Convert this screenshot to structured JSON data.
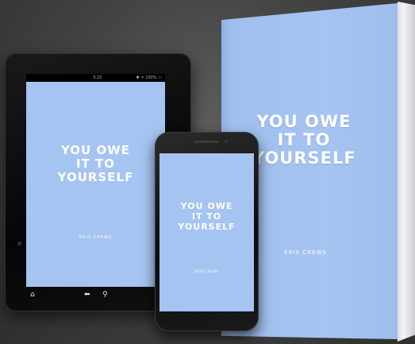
{
  "book": {
    "title": "YOU OWE\nIT TO\nYOURSELF",
    "author": "KRIS CREWS",
    "cover_color": "#a6c4f1"
  },
  "tablet": {
    "status_time": "3:23",
    "status_icons": "✱ ᯤ 100% ▭",
    "title": "YOU OWE\nIT TO\nYOURSELF",
    "author": "KRIS CREWS",
    "nav": {
      "home_icon": "home-icon",
      "back_icon": "back-icon",
      "search_icon": "search-icon",
      "home_glyph": "⌂",
      "back_glyph": "⬅",
      "search_glyph": "⚲"
    }
  },
  "phone": {
    "title": "YOU OWE\nIT TO\nYOURSELF",
    "author": "KRIS CREWS"
  }
}
